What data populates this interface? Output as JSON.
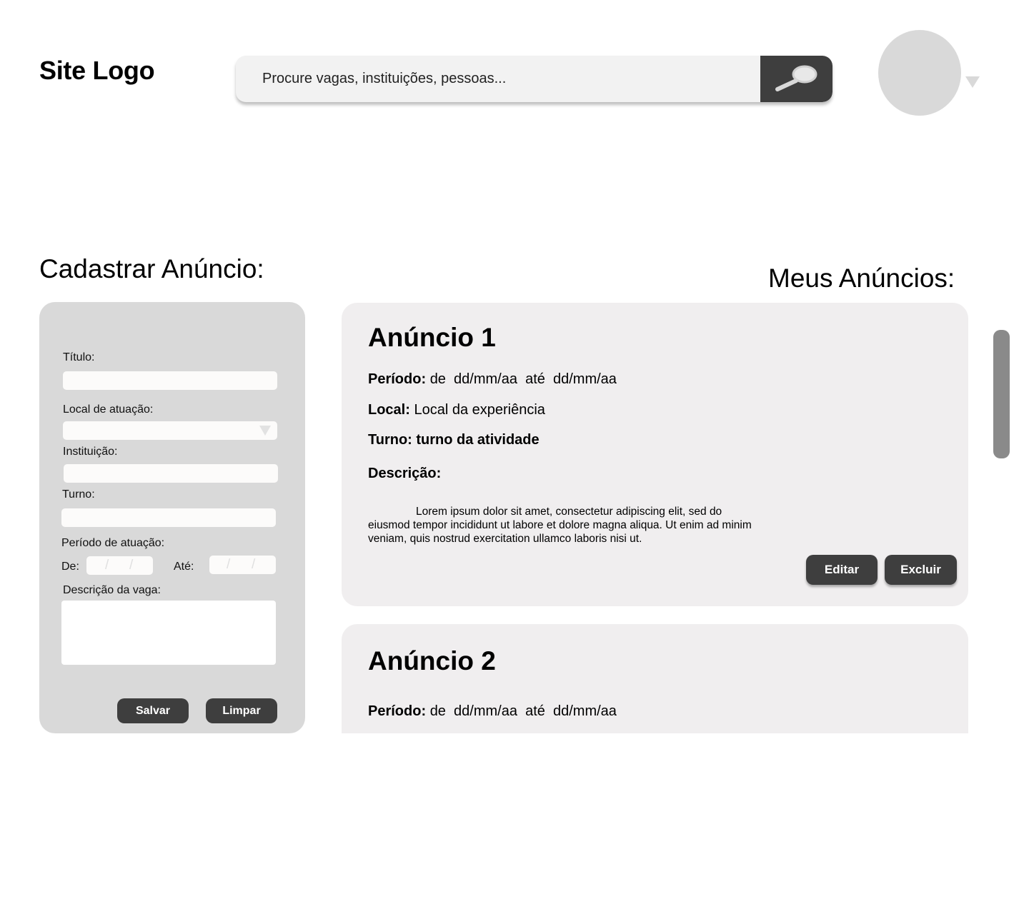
{
  "header": {
    "logo": "Site Logo",
    "search": {
      "placeholder": "Procure vagas, instituições, pessoas..."
    },
    "search_button_icon": "search-icon",
    "avatar_menu_icon": "caret-down-icon"
  },
  "form": {
    "title": "Cadastrar Anúncio:",
    "fields": {
      "titulo_label": "Título:",
      "local_label": "Local de atuação:",
      "instituicao_label": "Instituição:",
      "turno_label": "Turno:",
      "periodo_label": "Período de atuação:",
      "de_label": "De:",
      "ate_label": "Até:",
      "descricao_label": "Descrição da vaga:"
    },
    "buttons": {
      "save": "Salvar",
      "clear": "Limpar"
    }
  },
  "listing": {
    "title": "Meus Anúncios:",
    "ads": [
      {
        "title": "Anúncio 1",
        "period_label": "Período:",
        "period_value": "de  dd/mm/aa  até  dd/mm/aa",
        "local_label": "Local:",
        "local_value": "Local da experiência",
        "turno": "Turno: turno da atividade",
        "desc_label": "Descrição:",
        "description": "Lorem ipsum dolor sit amet, consectetur adipiscing elit, sed do eiusmod tempor incididunt ut labore et dolore magna aliqua. Ut enim ad minim veniam, quis nostrud exercitation ullamco laboris nisi ut.",
        "edit": "Editar",
        "delete": "Excluir"
      },
      {
        "title": "Anúncio 2",
        "period_label": "Período:",
        "period_value": "de  dd/mm/aa  até  dd/mm/aa"
      }
    ]
  }
}
